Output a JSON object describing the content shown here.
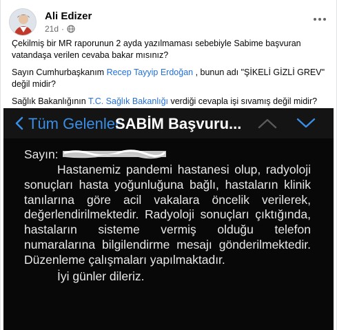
{
  "post": {
    "author": "Ali Edizer",
    "time": "21d",
    "paragraph1": "Çekilmiş bir MR raporunun 2 ayda yazılmaması sebebiyle Sabime başvuran vatandaşa verilen cevaba bakar mısınız?",
    "p2_before": "Sayın Cumhurbaşkanım ",
    "p2_link": "Recep Tayyip Erdoğan",
    "p2_after": " , bunun adı \"ŞİKELİ GİZLİ GREV\" değil midir?",
    "p3_before": "Sağlık Bakanlığının ",
    "p3_link": "T.C. Sağlık Bakanlığı",
    "p3_after": "  verdiği cevapla işi sıvamış değil midir?",
    "link_color": "#216fdb"
  },
  "phone": {
    "back_label": "Tüm Gelenler",
    "title": "SABİM Başvuru...",
    "accent": "#3a8ee6",
    "salutation": "Sayın:",
    "body": "Hastanemiz pandemi hastanesi olup, radyoloji sonuçları hasta yoğunluğuna bağlı, hastaların klinik tanılarına göre acil vakalara öncelik verilerek, değerlendirilmektedir. Radyoloji sonuçları çıktığında, hastaların sisteme vermiş olduğu telefon numaralarına bilgilendirme mesajı gönderilmektedir. Düzenleme çalışmaları yapılmaktadır.",
    "closing": "İyi günler dileriz."
  },
  "icons": {
    "globe": "globe-icon",
    "more": "more-options-icon",
    "back": "chevron-left-icon",
    "up": "chevron-up-icon",
    "down": "chevron-down-icon"
  }
}
